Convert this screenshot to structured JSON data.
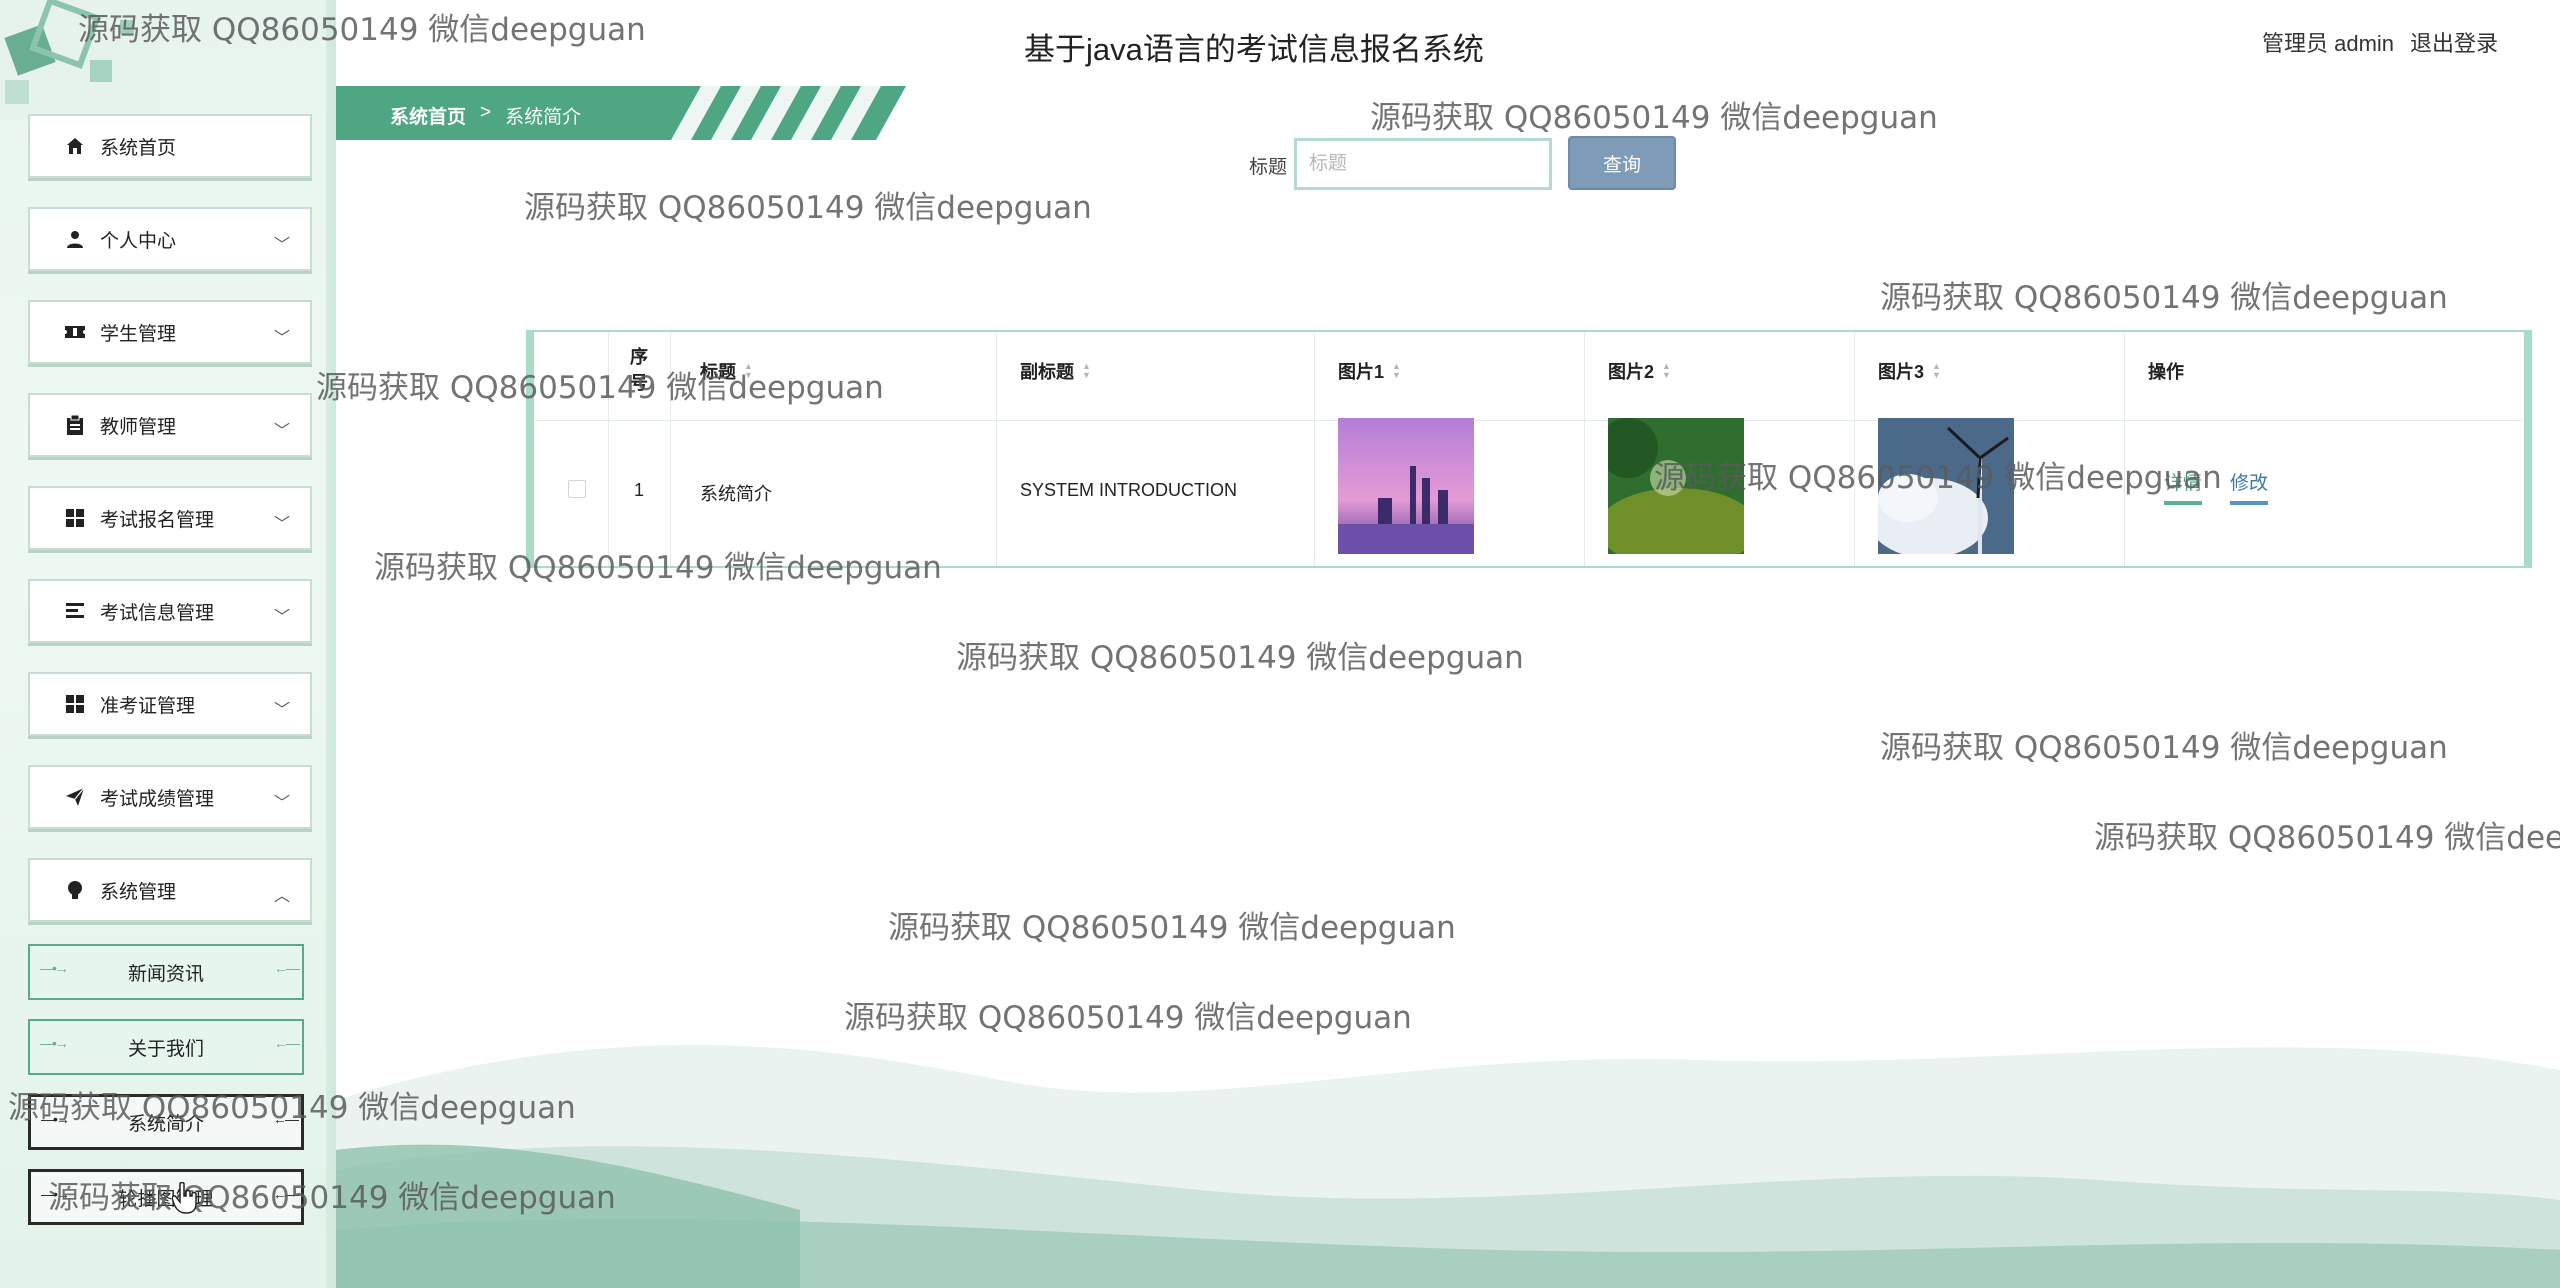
{
  "app": {
    "title": "基于java语言的考试信息报名系统"
  },
  "header": {
    "user_label": "管理员 admin",
    "logout_label": "退出登录"
  },
  "sidebar": {
    "items": [
      {
        "label": "系统首页",
        "icon": "home-icon"
      },
      {
        "label": "个人中心",
        "icon": "user-icon"
      },
      {
        "label": "学生管理",
        "icon": "ticket-icon"
      },
      {
        "label": "教师管理",
        "icon": "clipboard-icon"
      },
      {
        "label": "考试报名管理",
        "icon": "grid-icon"
      },
      {
        "label": "考试信息管理",
        "icon": "list-icon"
      },
      {
        "label": "准考证管理",
        "icon": "grid-icon"
      },
      {
        "label": "考试成绩管理",
        "icon": "send-icon"
      },
      {
        "label": "系统管理",
        "icon": "bulb-icon"
      }
    ],
    "sub_items": [
      {
        "label": "新闻资讯"
      },
      {
        "label": "关于我们"
      },
      {
        "label": "系统简介"
      },
      {
        "label": "轮播图管理"
      }
    ]
  },
  "breadcrumb": {
    "home": "系统首页",
    "separator": ">",
    "current": "系统简介"
  },
  "search": {
    "label": "标题",
    "placeholder": "标题",
    "value": "",
    "button_label": "查询"
  },
  "table": {
    "headers": {
      "index": "序号",
      "title": "标题",
      "subtitle": "副标题",
      "image1": "图片1",
      "image2": "图片2",
      "image3": "图片3",
      "actions": "操作"
    },
    "rows": [
      {
        "index": "1",
        "title": "系统简介",
        "subtitle": "SYSTEM INTRODUCTION",
        "detail_label": "详情",
        "edit_label": "修改"
      }
    ]
  },
  "watermark": {
    "text": "源码获取 QQ86050149 微信deepguan"
  },
  "colors": {
    "accent_green": "#5aa98a",
    "breadcrumb_green": "#4fa682",
    "search_button": "#7e9bb8",
    "table_border": "#a9dcc6"
  }
}
